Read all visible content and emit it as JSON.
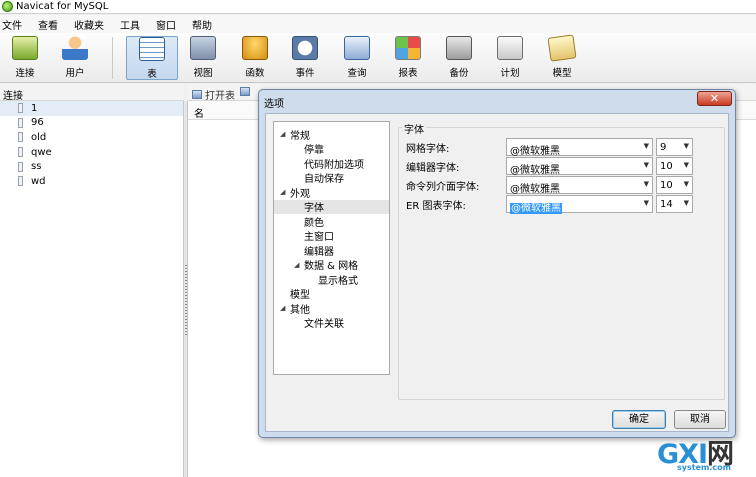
{
  "app": {
    "title": "Navicat for MySQL"
  },
  "menu": [
    "文件",
    "查看",
    "收藏夹",
    "工具",
    "窗口",
    "帮助"
  ],
  "toolbar": {
    "connect": "连接",
    "user": "用户",
    "table": "表",
    "view": "视图",
    "function": "函数",
    "event": "事件",
    "query": "查询",
    "report": "报表",
    "backup": "备份",
    "schedule": "计划",
    "model": "模型"
  },
  "connections": {
    "header": "连接",
    "items": [
      "1",
      "96",
      "old",
      "qwe",
      "ss",
      "wd"
    ]
  },
  "object_pane": {
    "open_table": "打开表",
    "name_column": "名"
  },
  "dialog": {
    "title": "选项",
    "close_glyph": "✕",
    "tree": {
      "general": "常规",
      "docking": "停靠",
      "code_options": "代码附加选项",
      "autosave": "自动保存",
      "appearance": "外观",
      "font": "字体",
      "color": "颜色",
      "main_window": "主窗口",
      "editor": "编辑器",
      "data_grid": "数据 & 网格",
      "display_format": "显示格式",
      "model": "模型",
      "other": "其他",
      "file_assoc": "文件关联"
    },
    "section": "字体",
    "fonts": [
      {
        "label": "网格字体:",
        "font": "@微软雅黑",
        "size": "9"
      },
      {
        "label": "编辑器字体:",
        "font": "@微软雅黑",
        "size": "10"
      },
      {
        "label": "命令列介面字体:",
        "font": "@微软雅黑",
        "size": "10"
      },
      {
        "label": "ER 图表字体:",
        "font": "@微软雅黑",
        "size": "14"
      }
    ],
    "ok": "确定",
    "cancel": "取消"
  },
  "watermark": {
    "letters_g": "G",
    "letters_xi": "X",
    "letters_i": "I",
    "net": "网",
    "domain": "system.com"
  }
}
